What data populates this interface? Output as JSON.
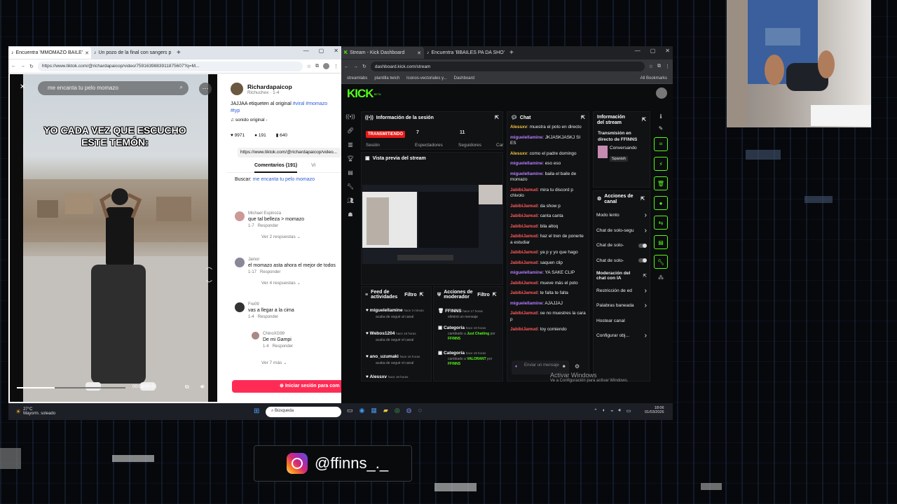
{
  "left_browser": {
    "tabs": [
      {
        "label": "Encuentra 'MMOMAZO BAILE'",
        "icon": "tiktok-icon"
      },
      {
        "label": "Un pozo de la final con sangers p",
        "icon": "tiktok-icon"
      }
    ],
    "url": "https://www.tiktok.com/@richardapaicop/video/7591639883911875607?q=M..."
  },
  "tiktok": {
    "search_placeholder": "me encanta tu pelo momazo",
    "caption": "YO CADA VEZ QUE ESCUCHO ESTE TEMÓN:",
    "time": "00:08/00:23",
    "author": "Richardapaicop",
    "author_sub": "Richuchex · 1-4",
    "description": "JAJJAA etiqueten al original",
    "hashtags": [
      "#viral",
      "#momazo",
      "#typ"
    ],
    "sound": "sonido original - ",
    "likes": "9971",
    "comments_count": "191",
    "saves": "640",
    "share_url": "https://www.tiktok.com/@richardapaicop/video...",
    "tab_comments": "Comentarios (191)",
    "tab_videos": "Vi",
    "search_label": "Buscar:",
    "search_term": "me encanta tu pelo momazo",
    "comments": [
      {
        "user": "Michael Espinoza",
        "text": "que tal belleza > momazo",
        "meta": "1-7",
        "reply": "Responder",
        "more": "Ver 2 respuestas"
      },
      {
        "user": "Jainor",
        "text": "el momazo asta ahora el mejor de todos",
        "meta": "1-17",
        "reply": "Responder",
        "more": "Ver 4 respuestas"
      },
      {
        "user": "Fre09",
        "text": "vas a llegar a la cima",
        "meta": "1-4",
        "reply": "Responder"
      },
      {
        "user": "ChinoXG99",
        "text": "De mi Gampi",
        "meta": "1-4",
        "reply": "Responder"
      }
    ],
    "more_replies": "Ver 7 más",
    "login_button": "Iniciar sesión para com"
  },
  "right_browser": {
    "tabs": [
      {
        "label": "Stream - Kick Dashboard",
        "icon": "kick-icon"
      },
      {
        "label": "Encuentra 'BBAILES PA DA SHO'",
        "icon": "tiktok-icon"
      }
    ],
    "url": "dashboard.kick.com/stream",
    "bookmarks": [
      "streamlabs",
      "plantilla twich",
      "Iconos-vectoriales y...",
      "Dashboard"
    ],
    "all_bookmarks": "All Bookmarks"
  },
  "kick": {
    "logo": "KICK",
    "logo_sup": "BETA",
    "session_title": "Información de la sesión",
    "live_badge": "TRANSMITIENDO",
    "stats": [
      {
        "value": "7",
        "label": "Espectadores"
      },
      {
        "value": "11",
        "label": "Seguidores"
      }
    ],
    "session_label": "Sesión",
    "truncated_label": "Car",
    "preview_title": "Vista previa del stream",
    "chat_title": "Chat",
    "chat": [
      {
        "user": "Alessxv",
        "text": "muestra el poto en directo",
        "color": "y"
      },
      {
        "user": "miguelellamine",
        "text": "JKJASKJASKJ SI ES",
        "color": "p"
      },
      {
        "user": "Alessxv",
        "text": "como el padre domingo",
        "color": "y"
      },
      {
        "user": "miguelellamine",
        "text": "eso eso",
        "color": "p"
      },
      {
        "user": "miguelellamine",
        "text": "baila el baile de momazo",
        "color": "p"
      },
      {
        "user": "JabibiJamud",
        "text": "mira tu discord p chivolo",
        "color": "r"
      },
      {
        "user": "JabibiJamud",
        "text": "da show p",
        "color": "r"
      },
      {
        "user": "JabibiJamud",
        "text": "canta canta",
        "color": "r"
      },
      {
        "user": "JabibiJamud",
        "text": "bila altoq",
        "color": "r"
      },
      {
        "user": "JabibiJamud",
        "text": "haz el tren de ponerte a estudiar",
        "color": "r"
      },
      {
        "user": "JabibiJamud",
        "text": "ya p y yo que hago",
        "color": "r"
      },
      {
        "user": "JabibiJamud",
        "text": "saquen clip",
        "color": "r"
      },
      {
        "user": "miguelellamine",
        "text": "YA SAKE CLIP",
        "color": "p"
      },
      {
        "user": "JabibiJamud",
        "text": "mueve más el poto",
        "color": "r"
      },
      {
        "user": "JabibiJamud",
        "text": "te falta te falta",
        "color": "r"
      },
      {
        "user": "miguelellamine",
        "text": "AJAJJAJ",
        "color": "p"
      },
      {
        "user": "JabibiJamud",
        "text": "oe no muestres la cara p",
        "color": "r"
      },
      {
        "user": "JabibiJamud",
        "text": "toy comiendo",
        "color": "r"
      }
    ],
    "chat_placeholder": "Enviar un mensaje",
    "stream_info_title": "Información del stream",
    "stream_info_text": "Transmisión en directo de FFINNS",
    "category": "Conversando",
    "language": "Spanish",
    "channel_actions_title": "Acciones de canal",
    "channel_actions": [
      {
        "label": "Modo lento",
        "kind": "chevron"
      },
      {
        "label": "Chat de solo-segu",
        "kind": "chevron"
      },
      {
        "label": "Chat de solo-",
        "kind": "toggle"
      },
      {
        "label": "Chat de solo-",
        "kind": "toggle"
      },
      {
        "label": "Moderación del chat con IA",
        "kind": "link"
      },
      {
        "label": "Restricción de ed",
        "kind": "chevron"
      },
      {
        "label": "Palabras baneada",
        "kind": "chevron"
      },
      {
        "label": "Hostear canal",
        "kind": "none"
      },
      {
        "label": "Configurar obj...",
        "kind": "chevron"
      }
    ],
    "feed_title": "Feed de actividades",
    "feed_filter": "Filtro",
    "feed": [
      {
        "user": "miguelellamine",
        "time": "hace 3 minuto",
        "text": "acaba de seguir al canal"
      },
      {
        "user": "Webos1204",
        "time": "hace 16 horas",
        "text": "acaba de seguir el canal"
      },
      {
        "user": "ano_uzumaki",
        "time": "hace 16 horas",
        "text": "acaba de seguir el canal"
      },
      {
        "user": "Alessxv",
        "time": "hace 18 horas",
        "text": ""
      }
    ],
    "mod_title": "Acciones de moderador",
    "mod_filter": "Filtro",
    "mod": [
      {
        "user": "FFINNS",
        "time": "hace 17 horas",
        "text": "eliminó un mensaje"
      },
      {
        "user": "Categoría",
        "time": "hace 19 horas",
        "text": "cambiado a",
        "highlight": "Just Chatting",
        "by": "por",
        "by_user": "FFINNS"
      },
      {
        "user": "Categoría",
        "time": "hace 19 horas",
        "text": "cambiado a",
        "highlight": "VALORANT",
        "by": "por",
        "by_user": "FFINNS"
      }
    ]
  },
  "watermark": {
    "line1": "Activar Windows",
    "line2": "Ve a Configuración para activar Windows."
  },
  "taskbar": {
    "temp": "27°C",
    "weather": "Mayorm. soleado",
    "search": "Búsqueda",
    "time": "18:06",
    "date": "01/03/2026"
  },
  "instagram": {
    "handle": "@ffinns_._"
  },
  "colors": {
    "kick_green": "#53fc18",
    "tiktok_pink": "#fe2c55",
    "live_red": "#e91916"
  }
}
